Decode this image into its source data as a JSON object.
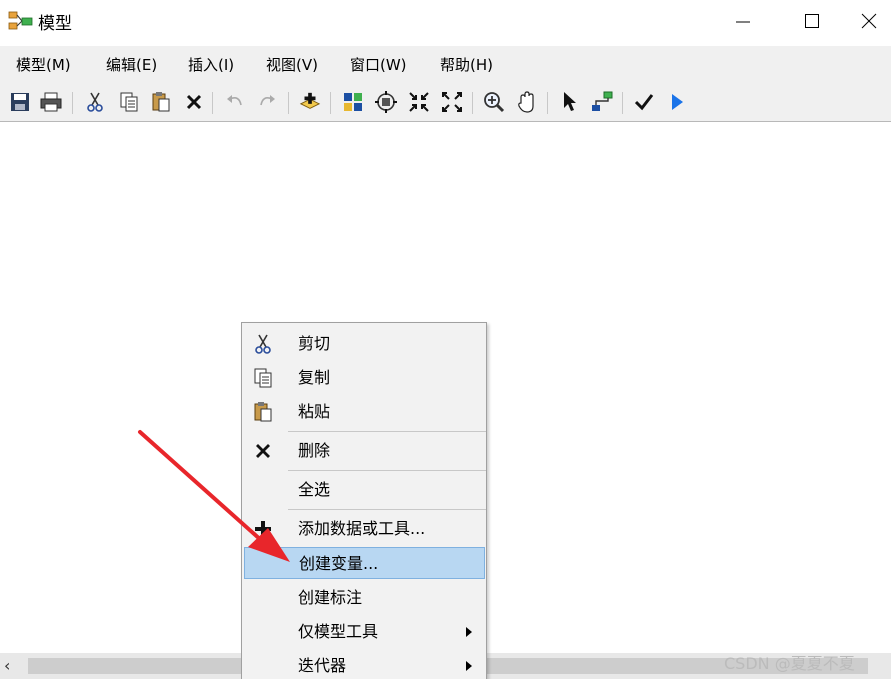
{
  "window": {
    "title": "模型",
    "icon": "model-icon",
    "controls": [
      "minimize",
      "maximize",
      "close"
    ]
  },
  "menu": {
    "items": [
      {
        "label": "模型(M)"
      },
      {
        "label": "编辑(E)"
      },
      {
        "label": "插入(I)"
      },
      {
        "label": "视图(V)"
      },
      {
        "label": "窗口(W)"
      },
      {
        "label": "帮助(H)"
      }
    ]
  },
  "toolbar": {
    "buttons": [
      "save-icon",
      "print-icon",
      "cut-icon",
      "copy-icon",
      "paste-icon",
      "delete-icon",
      "undo-icon",
      "redo-icon",
      "add-data-icon",
      "auto-layout-icon",
      "full-extent-icon",
      "fixed-zoom-in-icon",
      "fixed-zoom-out-icon",
      "zoom-in-icon",
      "pan-icon",
      "select-icon",
      "connect-icon",
      "validate-icon",
      "run-icon"
    ]
  },
  "context_menu": {
    "items": [
      {
        "label": "剪切",
        "icon": "scissors-icon"
      },
      {
        "label": "复制",
        "icon": "copy-icon"
      },
      {
        "label": "粘贴",
        "icon": "paste-icon"
      },
      {
        "label": "删除",
        "icon": "close-icon"
      },
      {
        "label": "全选",
        "icon": ""
      },
      {
        "label": "添加数据或工具...",
        "icon": "add-icon"
      },
      {
        "label": "创建变量...",
        "icon": "",
        "selected": true
      },
      {
        "label": "创建标注",
        "icon": ""
      },
      {
        "label": "仅模型工具",
        "icon": "",
        "submenu": true
      },
      {
        "label": "迭代器",
        "icon": "",
        "submenu": true
      }
    ]
  },
  "watermark": "CSDN @夏夏不夏",
  "colors": {
    "selection": "#b8d7f2",
    "arrow": "#e8262b",
    "run": "#1a73e8"
  }
}
